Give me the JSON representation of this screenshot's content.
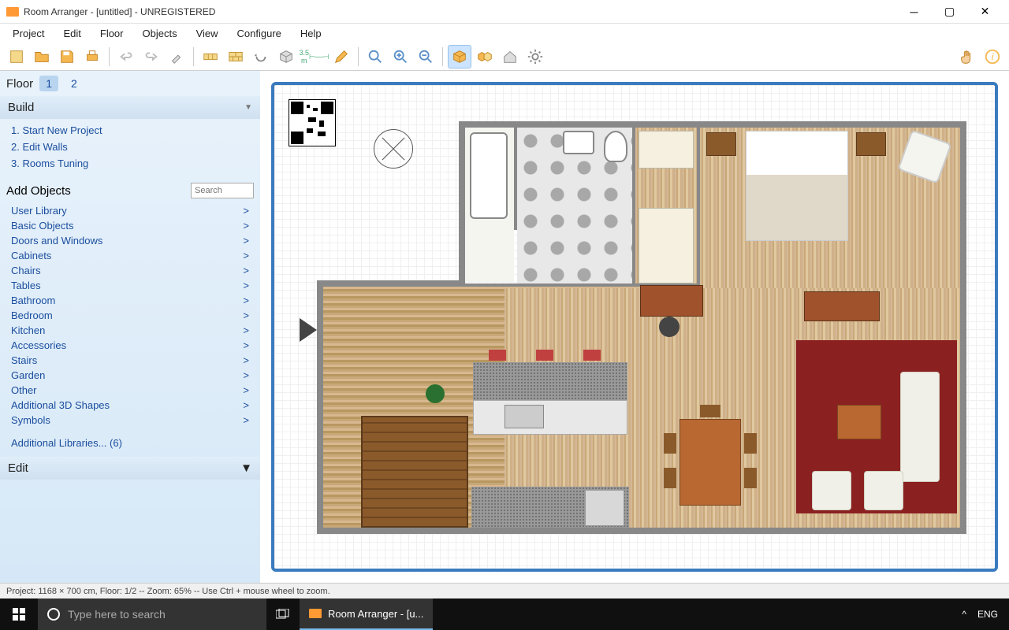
{
  "title": "Room Arranger - [untitled] - UNREGISTERED",
  "menu": [
    "Project",
    "Edit",
    "Floor",
    "Objects",
    "View",
    "Configure",
    "Help"
  ],
  "toolbar_tips": {
    "new": "New",
    "open": "Open",
    "save": "Save",
    "print": "Print",
    "undo": "Undo",
    "redo": "Redo",
    "paint": "Paint",
    "wall": "Wall",
    "brick": "Brick",
    "rotate": "Rotate",
    "box3d": "3D",
    "measure": "3.5 m",
    "pencil": "Pencil",
    "zoom": "Zoom",
    "zoomin": "Zoom In",
    "zoomout": "Zoom Out",
    "cube": "3D View",
    "cubes": "Multi",
    "home": "Home",
    "gear": "Settings",
    "hand": "Hand",
    "info": "Info"
  },
  "sidebar": {
    "floor_label": "Floor",
    "floors": [
      "1",
      "2"
    ],
    "active_floor": 0,
    "build_label": "Build",
    "build_links": [
      "1. Start New Project",
      "2. Edit Walls",
      "3. Rooms Tuning"
    ],
    "add_label": "Add Objects",
    "search_placeholder": "Search",
    "categories": [
      "User Library",
      "Basic Objects",
      "Doors and Windows",
      "Cabinets",
      "Chairs",
      "Tables",
      "Bathroom",
      "Bedroom",
      "Kitchen",
      "Accessories",
      "Stairs",
      "Garden",
      "Other",
      "Additional 3D Shapes",
      "Symbols"
    ],
    "additional_lib": "Additional Libraries... (6)",
    "edit_label": "Edit"
  },
  "status": "Project: 1168 × 700 cm, Floor: 1/2 -- Zoom: 65% -- Use Ctrl + mouse wheel to zoom.",
  "taskbar": {
    "search_placeholder": "Type here to search",
    "app_label": "Room Arranger - [u...",
    "tray_lang": "ENG",
    "tray_up": "^"
  }
}
